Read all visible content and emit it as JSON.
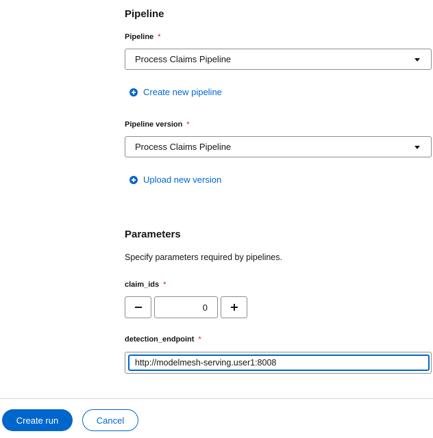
{
  "pipeline_section": {
    "title": "Pipeline",
    "pipeline_field": {
      "label": "Pipeline",
      "required_marker": "*",
      "value": "Process Claims Pipeline"
    },
    "create_link": "Create new pipeline",
    "version_field": {
      "label": "Pipeline version",
      "required_marker": "*",
      "value": "Process Claims Pipeline"
    },
    "upload_link": "Upload new version"
  },
  "parameters_section": {
    "title": "Parameters",
    "description": "Specify parameters required by pipelines.",
    "claim_ids": {
      "label": "claim_ids",
      "required_marker": "*",
      "value": "0"
    },
    "detection_endpoint": {
      "label": "detection_endpoint",
      "required_marker": "*",
      "value": "http://modelmesh-serving.user1:8008"
    }
  },
  "footer": {
    "primary_label": "Create run",
    "secondary_label": "Cancel"
  },
  "colors": {
    "accent": "#0066cc",
    "required": "#c9190b",
    "border": "#8a8d90",
    "divider": "#d2d2d2"
  },
  "icons": [
    "caret-down-icon",
    "plus-circle-icon",
    "minus-icon",
    "plus-icon"
  ]
}
